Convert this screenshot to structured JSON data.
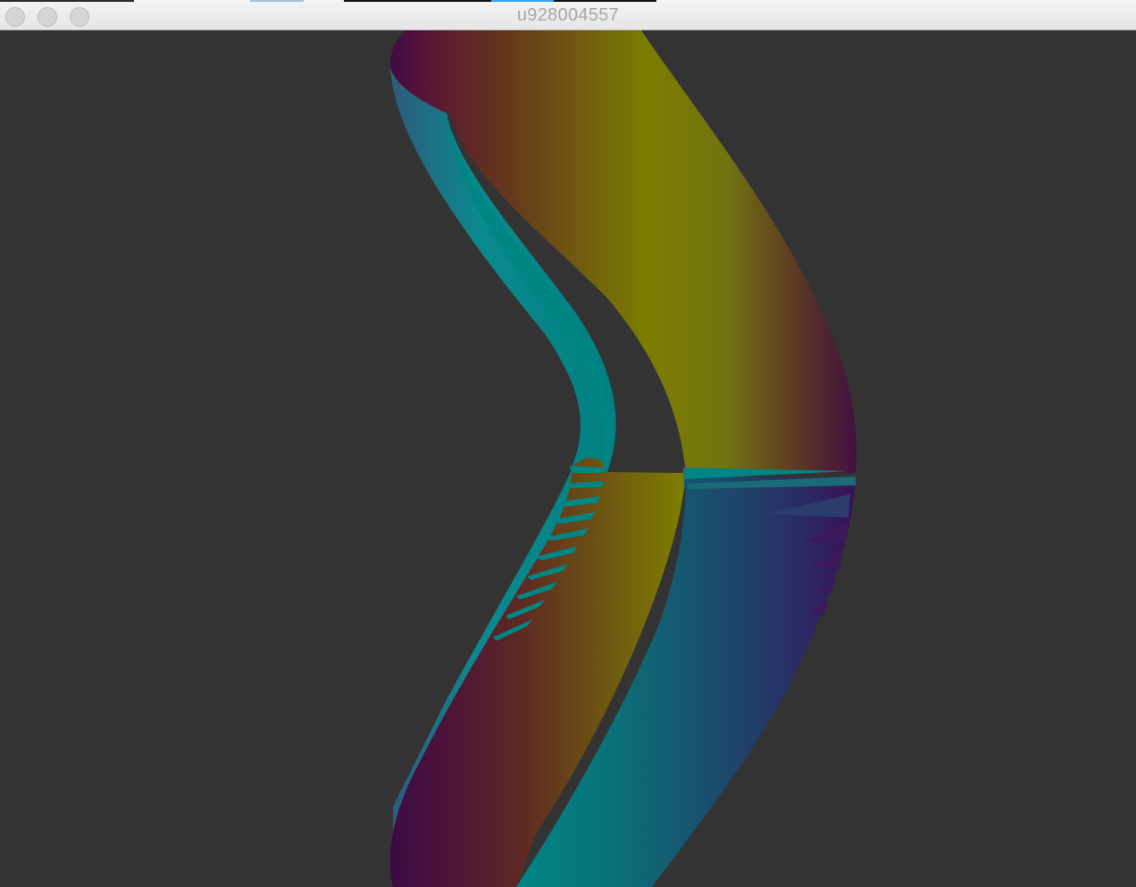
{
  "window": {
    "title": "u928004557"
  },
  "controls": {
    "close_icon": "circle",
    "minimize_icon": "circle",
    "zoom_icon": "circle"
  },
  "colors": {
    "background": "#333333",
    "band_purple": "#4a0f40",
    "band_olive": "#808000",
    "band_teal": "#008080",
    "band_navy": "#33145e"
  }
}
